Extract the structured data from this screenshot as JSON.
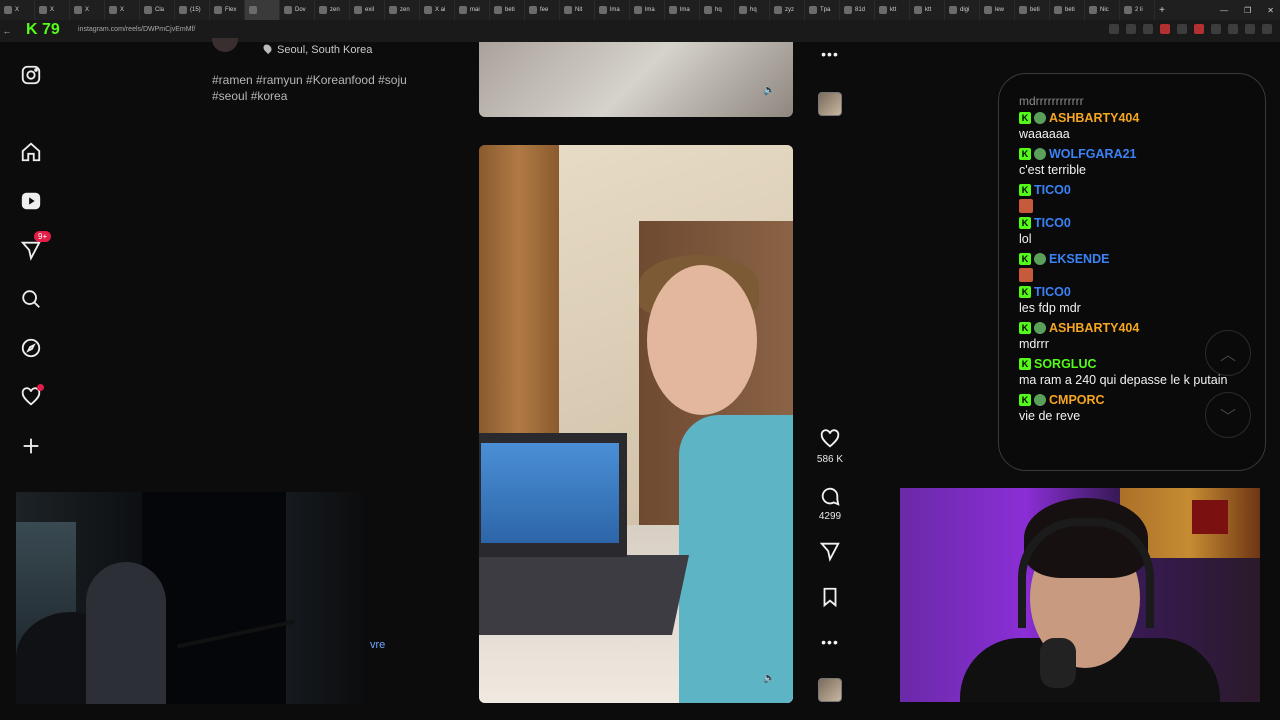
{
  "browser": {
    "tabs": [
      "X",
      "X",
      "X",
      "X",
      "Cla",
      "(15)",
      "Flex",
      "",
      "Dov",
      "zen",
      "exil",
      "zen",
      "X ai",
      "mai",
      "beti",
      "fee",
      "Nit",
      "lma",
      "lma",
      "lma",
      "hq",
      "hq",
      "zyz",
      "Tpa",
      "81d",
      "ktt",
      "ktt",
      "digi",
      "lew",
      "beti",
      "beti",
      "Nic",
      "2 li"
    ],
    "url": "instagram.com/reels/DWPmCjvEmMf/",
    "logo_text": "K 79"
  },
  "sidebar": {
    "notifications_badge": "9+"
  },
  "post": {
    "location": "Seoul, South Korea",
    "hashtags": "#ramen #ramyun #Koreanfood #soju #seoul #korea"
  },
  "actions": {
    "likes": "586 K",
    "comments": "4299"
  },
  "chat": {
    "top_faded": "mdrrrrrrrrrrrr",
    "messages": [
      {
        "user": "ASHBARTY404",
        "text": "waaaaaa",
        "color": "#f5a623"
      },
      {
        "user": "WOLFGARA21",
        "text": "c'est terrible",
        "color": "#3b82f6"
      },
      {
        "user": "TICO0",
        "text": "",
        "color": "#3b82f6"
      },
      {
        "user": "TICO0",
        "text": "lol",
        "color": "#3b82f6"
      },
      {
        "user": "EKSENDE",
        "text": "",
        "color": "#3b82f6"
      },
      {
        "user": "TICO0",
        "text": "les fdp mdr",
        "color": "#3b82f6"
      },
      {
        "user": "ASHBARTY404",
        "text": "mdrrr",
        "color": "#f5a623"
      },
      {
        "user": "SORGLUC",
        "text": "ma ram a 240 qui depasse le k putain",
        "color": "#53fc18"
      },
      {
        "user": "CMPORC",
        "text": "vie de reve",
        "color": "#f5a623"
      }
    ]
  },
  "webcam": {
    "left_partial_text": "vre"
  }
}
